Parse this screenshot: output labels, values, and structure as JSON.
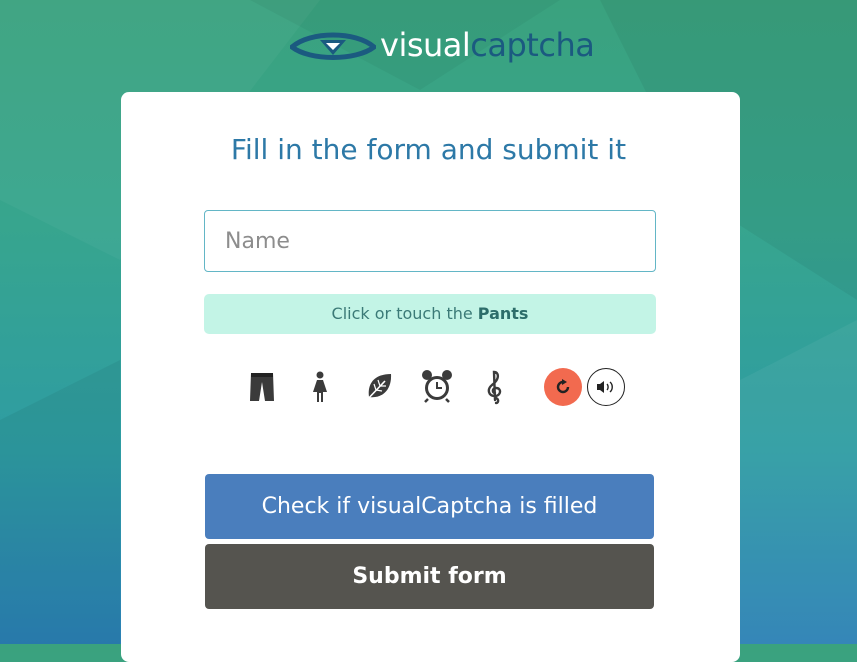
{
  "brand": {
    "logo_part1": "visual",
    "logo_part2": "captcha",
    "colors": {
      "accent": "#2d79a7",
      "dark_blue": "#1b5a80"
    }
  },
  "form": {
    "title": "Fill in the form and submit it",
    "name_field": {
      "placeholder": "Name",
      "value": ""
    }
  },
  "captcha": {
    "instruction_prefix": "Click or touch the",
    "target": "Pants",
    "options": [
      {
        "icon": "pants-icon"
      },
      {
        "icon": "woman-icon"
      },
      {
        "icon": "leaf-icon"
      },
      {
        "icon": "alarm-clock-icon"
      },
      {
        "icon": "treble-clef-icon"
      }
    ],
    "controls": {
      "refresh_icon": "refresh-icon",
      "audio_icon": "audio-icon",
      "refresh_color": "#f26a4f"
    }
  },
  "buttons": {
    "check_label": "Check if visualCaptcha is filled",
    "submit_label": "Submit form",
    "check_color": "#4a7ebd",
    "submit_color": "#55544f"
  }
}
